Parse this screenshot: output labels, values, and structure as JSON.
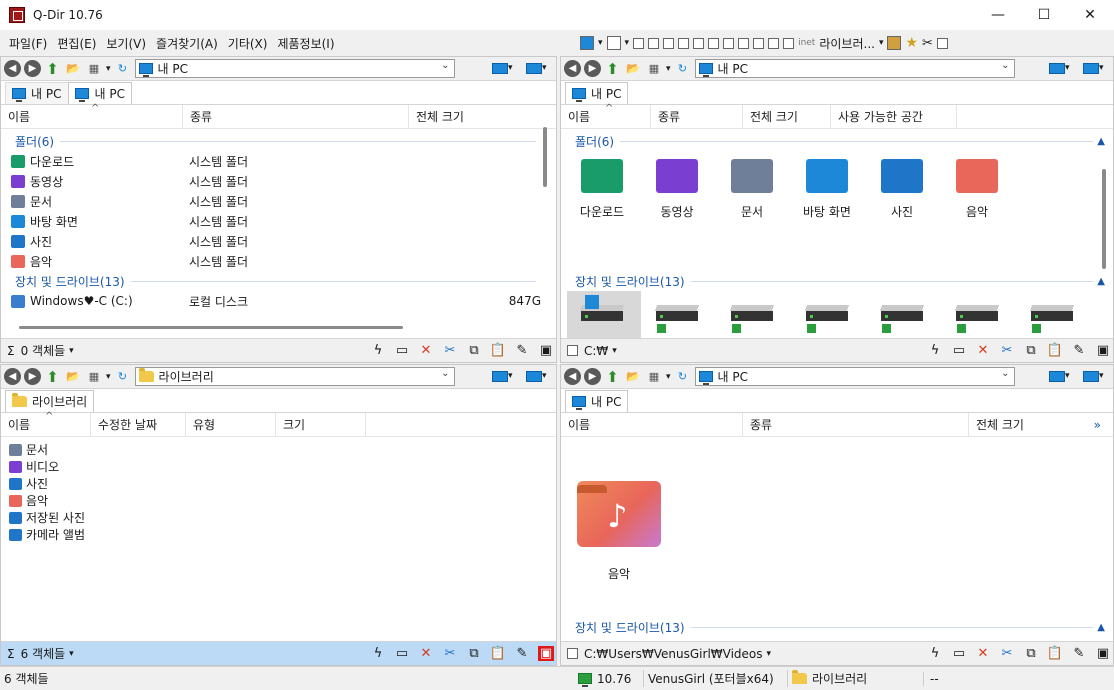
{
  "window": {
    "title": "Q-Dir 10.76",
    "minimize": "—",
    "maximize": "☐",
    "close": "✕"
  },
  "menu": [
    "파일(F)",
    "편집(E)",
    "보기(V)",
    "즐겨찾기(A)",
    "기타(X)",
    "제품정보(I)"
  ],
  "top_tools": {
    "library_label": "라이브러...",
    "inet_label": "inet"
  },
  "panes": {
    "top_left": {
      "address": "내 PC",
      "tabs": [
        "내 PC",
        "내 PC"
      ],
      "columns": [
        "이름",
        "종류",
        "전체 크기"
      ],
      "groups": {
        "folders": "폴더(6)",
        "drives": "장치 및 드라이브(13)"
      },
      "rows": [
        {
          "name": "다운로드",
          "type": "시스템 폴더",
          "size": "",
          "icon": "download-icon",
          "color": "#1a9b6a"
        },
        {
          "name": "동영상",
          "type": "시스템 폴더",
          "size": "",
          "icon": "video-icon",
          "color": "#7a3fd0"
        },
        {
          "name": "문서",
          "type": "시스템 폴더",
          "size": "",
          "icon": "document-icon",
          "color": "#6f7f99"
        },
        {
          "name": "바탕 화면",
          "type": "시스템 폴더",
          "size": "",
          "icon": "desktop-icon",
          "color": "#1e88d8"
        },
        {
          "name": "사진",
          "type": "시스템 폴더",
          "size": "",
          "icon": "picture-icon",
          "color": "#1f75c8"
        },
        {
          "name": "음악",
          "type": "시스템 폴더",
          "size": "",
          "icon": "music-icon",
          "color": "#e8665a"
        }
      ],
      "drive_row": {
        "name": "Windows♥-C (C:)",
        "type": "로컬 디스크",
        "size": "847G"
      },
      "status": "0 객체들"
    },
    "top_right": {
      "address": "내 PC",
      "tabs": [
        "내 PC"
      ],
      "columns": [
        "이름",
        "종류",
        "전체 크기",
        "사용 가능한 공간"
      ],
      "groups": {
        "folders": "폴더(6)",
        "drives": "장치 및 드라이브(13)"
      },
      "icons": [
        {
          "label": "다운로드",
          "icon": "download-folder-icon",
          "color": "#1a9b6a"
        },
        {
          "label": "동영상",
          "icon": "video-folder-icon",
          "color": "#7a3fd0"
        },
        {
          "label": "문서",
          "icon": "document-folder-icon",
          "color": "#6f7f99"
        },
        {
          "label": "바탕 화면",
          "icon": "desktop-folder-icon",
          "color": "#1e88d8"
        },
        {
          "label": "사진",
          "icon": "pictures-folder-icon",
          "color": "#1f75c8"
        },
        {
          "label": "음악",
          "icon": "music-folder-icon",
          "color": "#e8665a"
        }
      ],
      "status": "C:₩"
    },
    "bottom_left": {
      "address": "라이브러리",
      "tabs": [
        "라이브러리"
      ],
      "columns": [
        "이름",
        "수정한 날짜",
        "유형",
        "크기"
      ],
      "rows": [
        {
          "name": "문서",
          "icon": "document-icon",
          "color": "#6f7f99"
        },
        {
          "name": "비디오",
          "icon": "video-icon",
          "color": "#7a3fd0"
        },
        {
          "name": "사진",
          "icon": "picture-icon",
          "color": "#1f75c8"
        },
        {
          "name": "음악",
          "icon": "music-icon",
          "color": "#e8665a"
        },
        {
          "name": "저장된 사진",
          "icon": "picture-icon",
          "color": "#1f75c8"
        },
        {
          "name": "카메라 앨범",
          "icon": "picture-icon",
          "color": "#1f75c8"
        }
      ],
      "status": "6 객체들"
    },
    "bottom_right": {
      "address": "내 PC",
      "tabs": [
        "내 PC"
      ],
      "columns": [
        "이름",
        "종류",
        "전체 크기"
      ],
      "big_item": {
        "label": "음악",
        "color": "#e8665a"
      },
      "groups": {
        "drives": "장치 및 드라이브(13)"
      },
      "status": "C:₩Users₩VenusGirl₩Videos"
    }
  },
  "bottom_bar": {
    "count": "6 객체들",
    "version": "10.76",
    "user": "VenusGirl (포터블x64)",
    "location": "라이브러리",
    "extra": "--"
  }
}
